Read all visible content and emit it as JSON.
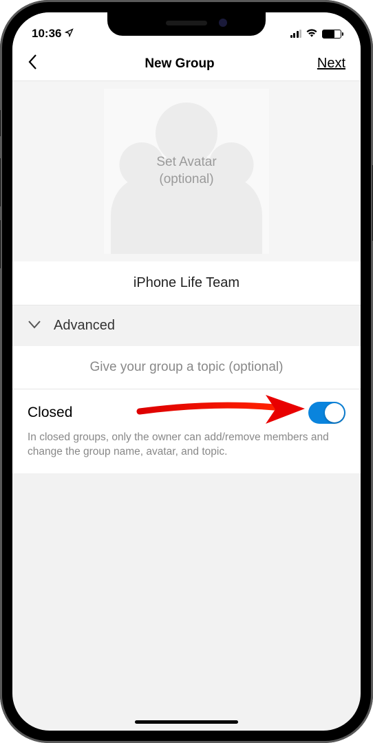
{
  "status": {
    "time": "10:36"
  },
  "nav": {
    "title": "New Group",
    "next": "Next"
  },
  "avatar": {
    "line1": "Set Avatar",
    "line2": "(optional)"
  },
  "group_name": "iPhone Life Team",
  "advanced": {
    "label": "Advanced"
  },
  "topic": {
    "placeholder": "Give your group a topic (optional)"
  },
  "closed": {
    "label": "Closed",
    "description": "In closed groups, only the owner can add/remove members and change the group name, avatar, and topic.",
    "toggle_on": true
  }
}
